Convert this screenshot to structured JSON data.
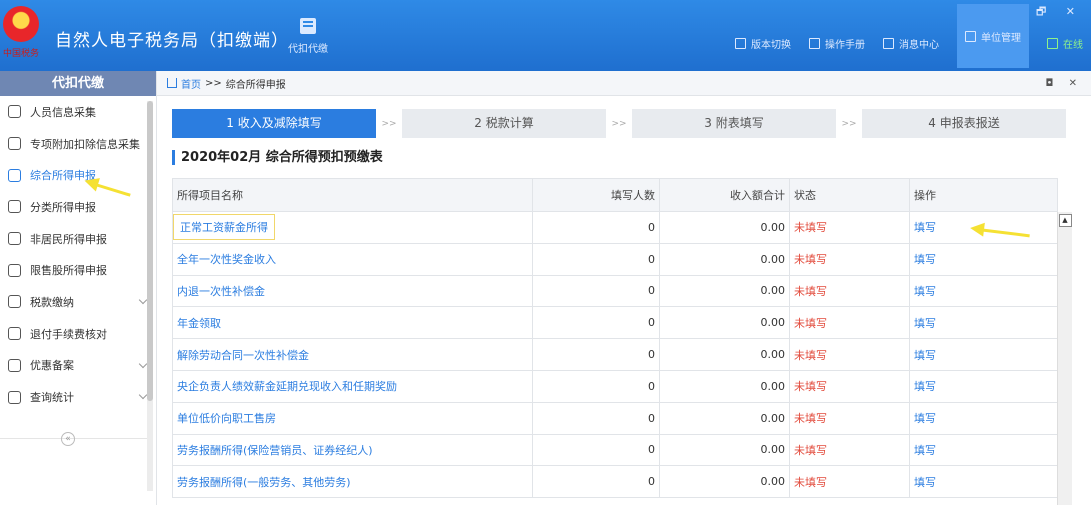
{
  "app": {
    "title": "自然人电子税务局（扣缴端）",
    "logo_text": "中国税务",
    "top_tab": "代扣代缴",
    "actions": [
      "版本切换",
      "操作手册",
      "消息中心",
      "单位管理",
      "在线"
    ],
    "window_controls": "– 🗗 ✕"
  },
  "sidebar": {
    "header": "代扣代缴",
    "items": [
      {
        "label": "人员信息采集",
        "icon": "person-icon"
      },
      {
        "label": "专项附加扣除信息采集",
        "icon": "list-icon"
      },
      {
        "label": "综合所得申报",
        "icon": "layers-icon"
      },
      {
        "label": "分类所得申报",
        "icon": "clock-icon"
      },
      {
        "label": "非居民所得申报",
        "icon": "user-outline-icon"
      },
      {
        "label": "限售股所得申报",
        "icon": "bar-chart-icon"
      },
      {
        "label": "税款缴纳",
        "icon": "folder-icon"
      },
      {
        "label": "退付手续费核对",
        "icon": "doc-icon"
      },
      {
        "label": "优惠备案",
        "icon": "card-icon"
      },
      {
        "label": "查询统计",
        "icon": "search-list-icon"
      }
    ],
    "collapse": "«"
  },
  "breadcrumb": {
    "home": "首页",
    "sep": ">>",
    "current": "综合所得申报",
    "controls": "◘ ✕"
  },
  "steps": [
    {
      "label": "1 收入及减除填写"
    },
    {
      "label": "2 税款计算"
    },
    {
      "label": "3 附表填写"
    },
    {
      "label": "4 申报表报送"
    }
  ],
  "step_arrow": ">>",
  "form_title": "2020年02月  综合所得预扣预缴表",
  "table": {
    "headers": [
      "所得项目名称",
      "填写人数",
      "收入额合计",
      "状态",
      "操作"
    ],
    "rows": [
      {
        "name": "正常工资薪金所得",
        "count": "0",
        "income": "0.00",
        "status": "未填写",
        "action": "填写"
      },
      {
        "name": "全年一次性奖金收入",
        "count": "0",
        "income": "0.00",
        "status": "未填写",
        "action": "填写"
      },
      {
        "name": "内退一次性补偿金",
        "count": "0",
        "income": "0.00",
        "status": "未填写",
        "action": "填写"
      },
      {
        "name": "年金领取",
        "count": "0",
        "income": "0.00",
        "status": "未填写",
        "action": "填写"
      },
      {
        "name": "解除劳动合同一次性补偿金",
        "count": "0",
        "income": "0.00",
        "status": "未填写",
        "action": "填写"
      },
      {
        "name": "央企负责人绩效薪金延期兑现收入和任期奖励",
        "count": "0",
        "income": "0.00",
        "status": "未填写",
        "action": "填写"
      },
      {
        "name": "单位低价向职工售房",
        "count": "0",
        "income": "0.00",
        "status": "未填写",
        "action": "填写"
      },
      {
        "name": "劳务报酬所得(保险营销员、证券经纪人)",
        "count": "0",
        "income": "0.00",
        "status": "未填写",
        "action": "填写"
      },
      {
        "name": "劳务报酬所得(一般劳务、其他劳务)",
        "count": "0",
        "income": "0.00",
        "status": "未填写",
        "action": "填写"
      }
    ]
  },
  "colors": {
    "primary": "#2b7de0",
    "status_red": "#e24a3b",
    "titlebar": "#1f6fcf"
  }
}
